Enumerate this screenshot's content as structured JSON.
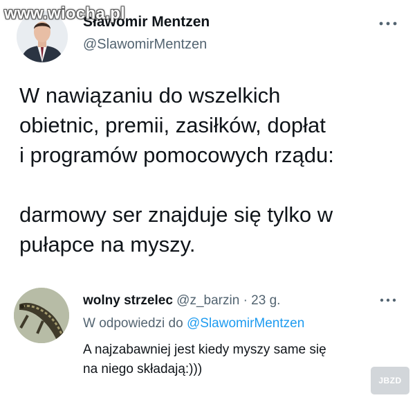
{
  "watermark": {
    "text": "www.wiocha.pl"
  },
  "tweet": {
    "author_name": "Sławomir Mentzen",
    "author_handle": "@SlawomirMentzen",
    "more_icon": "more-horizontal-icon",
    "text_lines": [
      "W nawiązaniu do wszelkich",
      "obietnic, premii, zasiłków, dopłat",
      "i programów pomocowych rządu:",
      "darmowy ser znajduje się tylko w",
      "pułapce na myszy."
    ]
  },
  "reply": {
    "author_name": "wolny strzelec",
    "author_handle": "@z_barzin",
    "separator": "·",
    "time": "23 g.",
    "reply_to_label": "W odpowiedzi do",
    "reply_to_handle": "@SlawomirMentzen",
    "text_lines": [
      "A najzabawniej jest kiedy myszy same się",
      "na niego składają:)))"
    ]
  },
  "corner_logo": {
    "text": "JBZD"
  },
  "colors": {
    "text_primary": "#0f1419",
    "text_secondary": "#536471",
    "link": "#1d9bf0"
  }
}
